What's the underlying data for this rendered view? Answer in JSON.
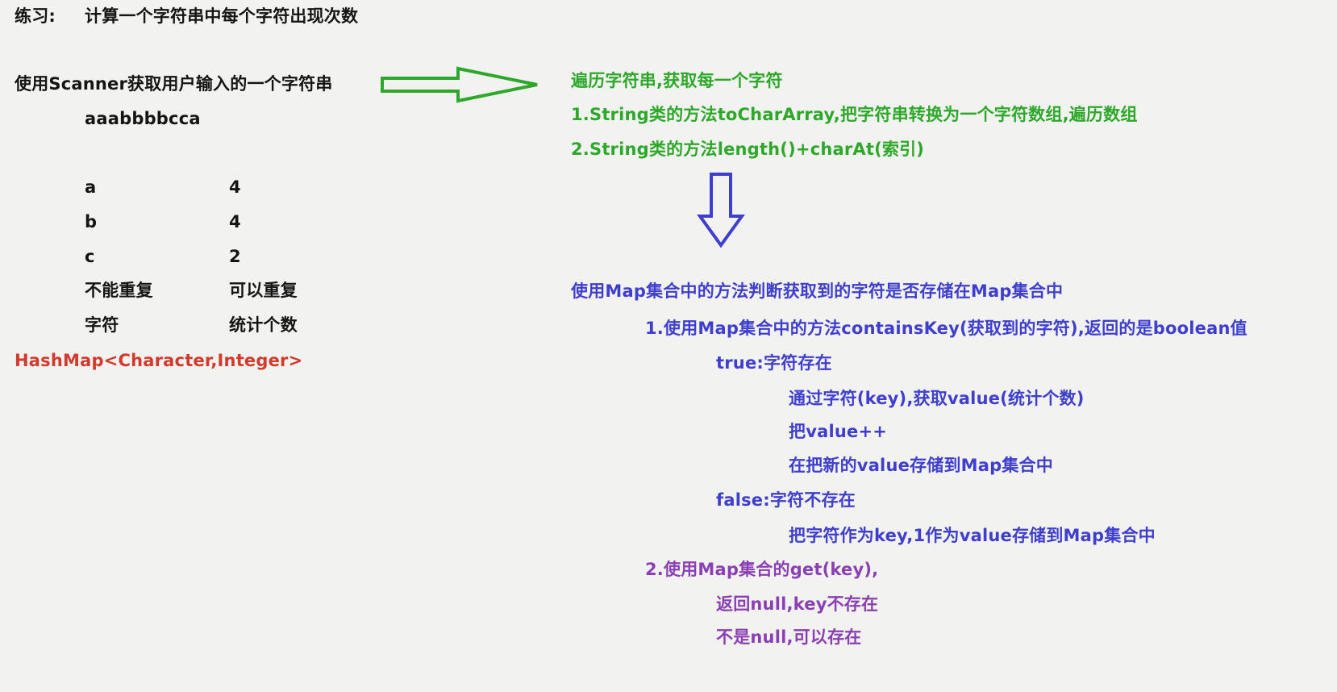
{
  "exercise": {
    "label": "练习:",
    "title": "计算一个字符串中每个字符出现次数"
  },
  "input": {
    "description": "使用Scanner获取用户输入的一个字符串",
    "sample": "aaabbbbcca"
  },
  "counts": [
    {
      "char": "a",
      "count": "4"
    },
    {
      "char": "b",
      "count": "4"
    },
    {
      "char": "c",
      "count": "2"
    }
  ],
  "key_note": [
    "不能重复",
    "字符"
  ],
  "value_note": [
    "可以重复",
    "统计个数"
  ],
  "map_type": "HashMap<Character,Integer>",
  "traverse": {
    "heading": "遍历字符串,获取每一个字符",
    "method1": "1.String类的方法toCharArray,把字符串转换为一个字符数组,遍历数组",
    "method2": "2.String类的方法length()+charAt(索引)"
  },
  "map_check": {
    "heading": "使用Map集合中的方法判断获取到的字符是否存储在Map集合中",
    "way1": "1.使用Map集合中的方法containsKey(获取到的字符),返回的是boolean值",
    "true_case": "true:字符存在",
    "true_steps": [
      "通过字符(key),获取value(统计个数)",
      "把value++",
      "在把新的value存储到Map集合中"
    ],
    "false_case": "false:字符不存在",
    "false_step": "把字符作为key,1作为value存储到Map集合中",
    "way2": "2.使用Map集合的get(key),",
    "way2_null": "返回null,key不存在",
    "way2_notnull": "不是null,可以存在"
  },
  "colors": {
    "background": "#f2f2f0",
    "text": "#151515",
    "green": "#2ea82a",
    "blue": "#3f3fcf",
    "purple": "#8b3fb4",
    "red": "#d23a2c"
  }
}
